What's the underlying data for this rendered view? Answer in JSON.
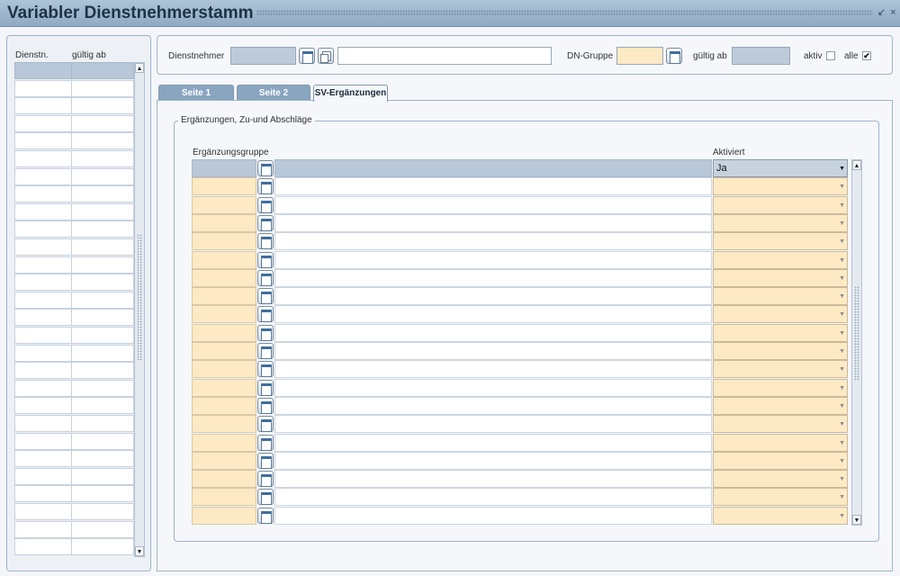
{
  "window": {
    "title": "Variabler Dienstnehmerstamm",
    "pin_glyph": "↙",
    "close_glyph": "×"
  },
  "left_list": {
    "col_dienstn": "Dienstn.",
    "col_gueltig_ab": "gültig ab",
    "row_count": 28
  },
  "header": {
    "dienstnehmer_label": "Dienstnehmer",
    "dn_gruppe_label": "DN-Gruppe",
    "gueltig_ab_label": "gültig ab",
    "aktiv_label": "aktiv",
    "aktiv_checked": false,
    "alle_label": "alle",
    "alle_checked": true,
    "check_glyph": "✔"
  },
  "tabs": [
    {
      "label": "Seite 1",
      "active": false
    },
    {
      "label": "Seite 2",
      "active": false
    },
    {
      "label": "SV-Ergänzungen",
      "active": true
    }
  ],
  "section": {
    "legend": "Ergänzungen, Zu-und Abschläge",
    "col_gruppe": "Ergänzungsgruppe",
    "col_aktiviert": "Aktiviert",
    "first_row_aktiviert": "Ja",
    "row_count": 20
  },
  "scroll": {
    "up_glyph": "▲",
    "down_glyph": "▼",
    "dropdown_glyph": "▼"
  },
  "colors": {
    "titlebar": "#9ab2c9",
    "tab_inactive": "#8aa5c0",
    "field_yellow": "#fde9c4",
    "field_gray": "#bccbda",
    "selected_row": "#b8c8d8"
  }
}
